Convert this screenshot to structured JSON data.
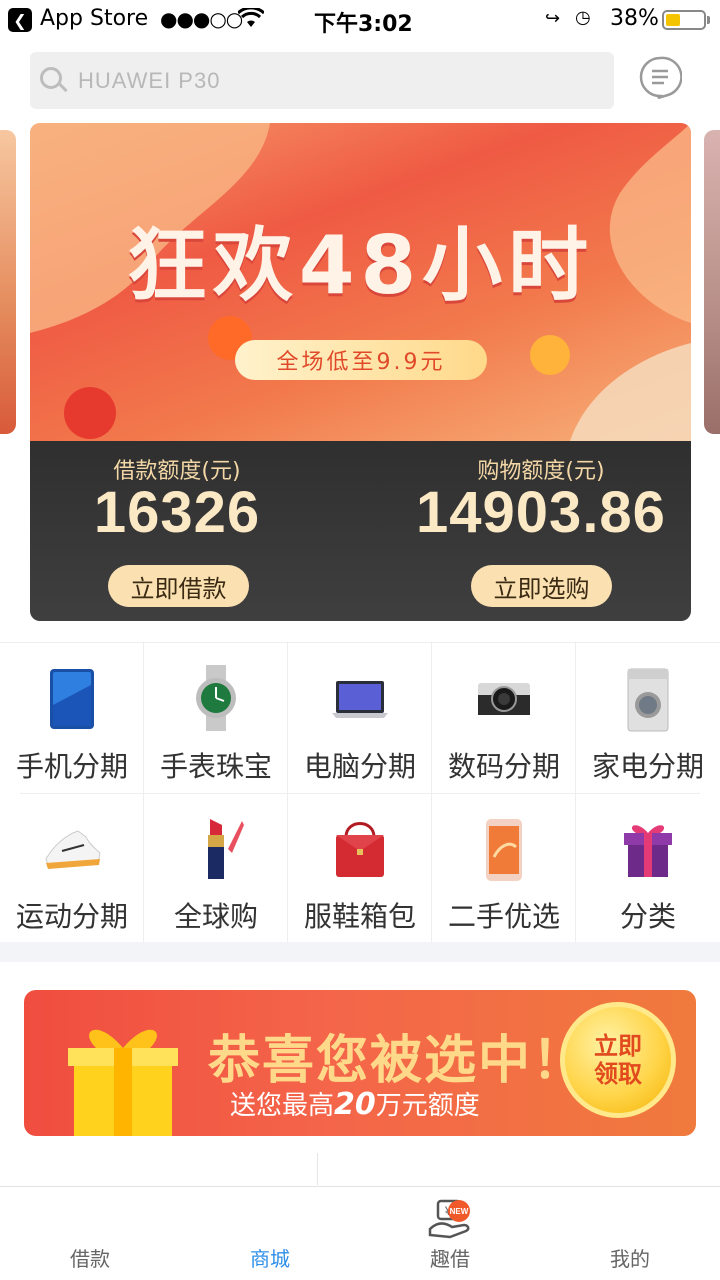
{
  "status_bar": {
    "back_app": "App Store",
    "time": "下午3:02",
    "battery": "38%",
    "battery_level": 0.38,
    "icons": [
      "back-icon",
      "signal-dots-icon",
      "wifi-icon",
      "rotation-lock-icon",
      "alarm-lock-icon",
      "battery-icon"
    ]
  },
  "search": {
    "placeholder": "HUAWEI P30",
    "icon": "search-icon"
  },
  "header": {
    "message_icon": "message-bubble-icon"
  },
  "banner": {
    "title": "狂欢48小时",
    "subtitle": "全场低至9.9元"
  },
  "credit": {
    "loan": {
      "label": "借款额度(元)",
      "value": "16326",
      "button": "立即借款"
    },
    "shopping": {
      "label": "购物额度(元)",
      "value": "14903.86",
      "button": "立即选购"
    }
  },
  "categories": [
    {
      "label": "手机分期",
      "icon": "phone-icon"
    },
    {
      "label": "手表珠宝",
      "icon": "watch-icon"
    },
    {
      "label": "电脑分期",
      "icon": "laptop-icon"
    },
    {
      "label": "数码分期",
      "icon": "camera-icon"
    },
    {
      "label": "家电分期",
      "icon": "washing-machine-icon"
    },
    {
      "label": "运动分期",
      "icon": "sneaker-icon"
    },
    {
      "label": "全球购",
      "icon": "lipstick-icon"
    },
    {
      "label": "服鞋箱包",
      "icon": "handbag-icon"
    },
    {
      "label": "二手优选",
      "icon": "iphone-icon"
    },
    {
      "label": "分类",
      "icon": "gift-box-icon"
    }
  ],
  "promo": {
    "title": "恭喜您被选中！",
    "subtitle_pre": "送您最高",
    "subtitle_amount": "20",
    "subtitle_post": "万元额度",
    "button": "立即领取"
  },
  "tabbar": [
    {
      "label": "借款",
      "icon": "loan-icon",
      "active": false
    },
    {
      "label": "商城",
      "icon": "mall-icon",
      "active": true
    },
    {
      "label": "趣借",
      "icon": "fun-loan-icon",
      "active": false,
      "badge": "NEW"
    },
    {
      "label": "我的",
      "icon": "profile-icon",
      "active": false
    }
  ],
  "colors": {
    "accent": "#2f8fe8",
    "banner_red": "#ef5a44",
    "credit_gold": "#fbe8c4",
    "badge": "#f05a2b"
  }
}
